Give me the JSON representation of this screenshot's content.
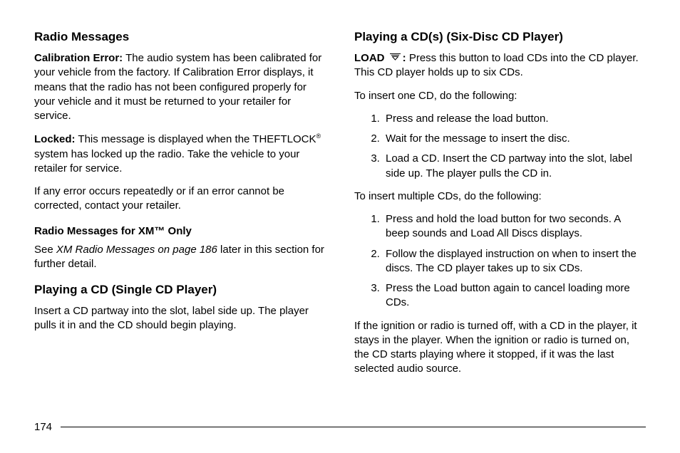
{
  "left": {
    "heading1": "Radio Messages",
    "p1_bold": "Calibration Error:",
    "p1": "The audio system has been calibrated for your vehicle from the factory. If Calibration Error displays, it means that the radio has not been configured properly for your vehicle and it must be returned to your retailer for service.",
    "p2_bold": "Locked:",
    "p2a": "This message is displayed when the THEFTLOCK",
    "p2_sup": "®",
    "p2b": "system has locked up the radio. Take the vehicle to your retailer for service.",
    "p3": "If any error occurs repeatedly or if an error cannot be corrected, contact your retailer.",
    "heading2": "Radio Messages for XM™ Only",
    "p4a": "See",
    "p4_italic": "XM Radio Messages on page 186",
    "p4b": "later in this section for further detail.",
    "heading3": "Playing a CD (Single CD Player)",
    "p5": "Insert a CD partway into the slot, label side up. The player pulls it in and the CD should begin playing."
  },
  "right": {
    "heading1": "Playing a CD(s) (Six-Disc CD Player)",
    "p1_bold": "LOAD",
    "p1_colon": ":",
    "p1": "Press this button to load CDs into the CD player. This CD player holds up to six CDs.",
    "p2": "To insert one CD, do the following:",
    "list1": [
      "Press and release the load button.",
      "Wait for the message to insert the disc.",
      "Load a CD. Insert the CD partway into the slot, label side up. The player pulls the CD in."
    ],
    "p3": "To insert multiple CDs, do the following:",
    "list2": [
      "Press and hold the load button for two seconds. A beep sounds and Load All Discs displays.",
      "Follow the displayed instruction on when to insert the discs. The CD player takes up to six CDs.",
      "Press the Load button again to cancel loading more CDs."
    ],
    "p4": "If the ignition or radio is turned off, with a CD in the player, it stays in the player. When the ignition or radio is turned on, the CD starts playing where it stopped, if it was the last selected audio source."
  },
  "page_number": "174"
}
